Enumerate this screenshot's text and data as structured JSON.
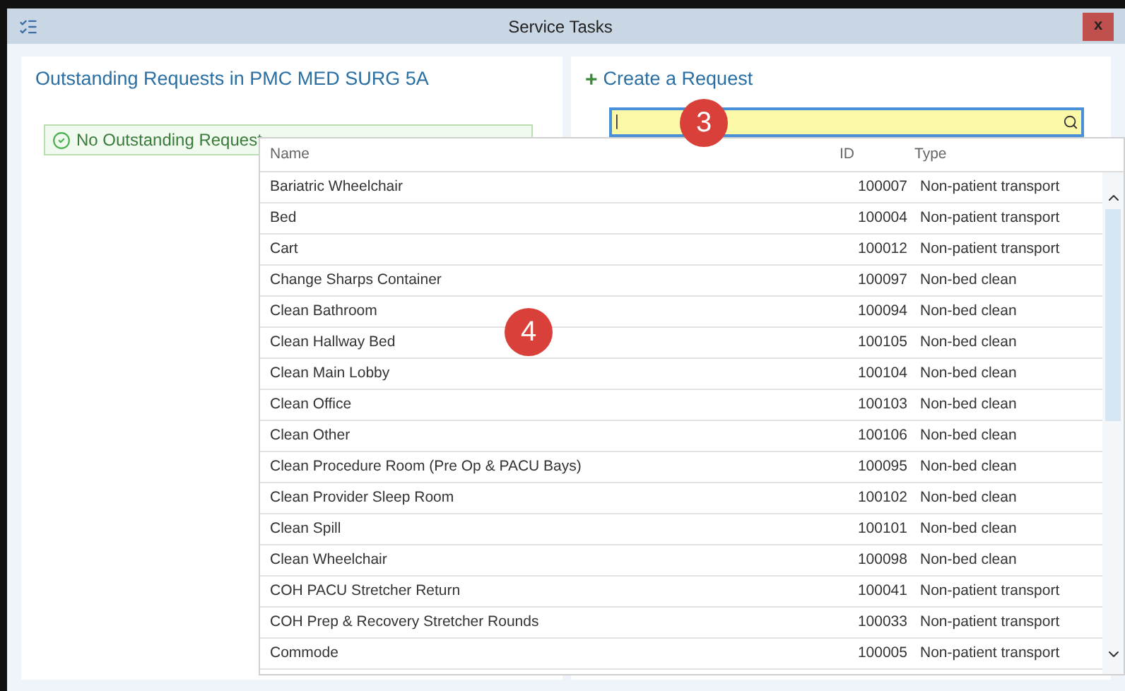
{
  "window": {
    "title": "Service Tasks",
    "close": "x"
  },
  "outstanding": {
    "title": "Outstanding Requests in PMC MED SURG 5A",
    "message": "No Outstanding Request"
  },
  "create": {
    "plus": "+",
    "title": "Create a Request",
    "search_value": "|"
  },
  "callouts": [
    "3",
    "4"
  ],
  "results": {
    "columns": [
      "Name",
      "ID",
      "Type"
    ],
    "rows": [
      {
        "name": "Bariatric Wheelchair",
        "id": "100007",
        "type": "Non-patient transport"
      },
      {
        "name": "Bed",
        "id": "100004",
        "type": "Non-patient transport"
      },
      {
        "name": "Cart",
        "id": "100012",
        "type": "Non-patient transport"
      },
      {
        "name": "Change Sharps Container",
        "id": "100097",
        "type": "Non-bed clean"
      },
      {
        "name": "Clean Bathroom",
        "id": "100094",
        "type": "Non-bed clean"
      },
      {
        "name": "Clean Hallway Bed",
        "id": "100105",
        "type": "Non-bed clean"
      },
      {
        "name": "Clean Main Lobby",
        "id": "100104",
        "type": "Non-bed clean"
      },
      {
        "name": "Clean Office",
        "id": "100103",
        "type": "Non-bed clean"
      },
      {
        "name": "Clean Other",
        "id": "100106",
        "type": "Non-bed clean"
      },
      {
        "name": "Clean Procedure Room (Pre Op & PACU Bays)",
        "id": "100095",
        "type": "Non-bed clean"
      },
      {
        "name": "Clean Provider Sleep Room",
        "id": "100102",
        "type": "Non-bed clean"
      },
      {
        "name": "Clean Spill",
        "id": "100101",
        "type": "Non-bed clean"
      },
      {
        "name": "Clean Wheelchair",
        "id": "100098",
        "type": "Non-bed clean"
      },
      {
        "name": "COH PACU Stretcher Return",
        "id": "100041",
        "type": "Non-patient transport"
      },
      {
        "name": "COH Prep & Recovery Stretcher Rounds",
        "id": "100033",
        "type": "Non-patient transport"
      },
      {
        "name": "Commode",
        "id": "100005",
        "type": "Non-patient transport"
      }
    ]
  }
}
